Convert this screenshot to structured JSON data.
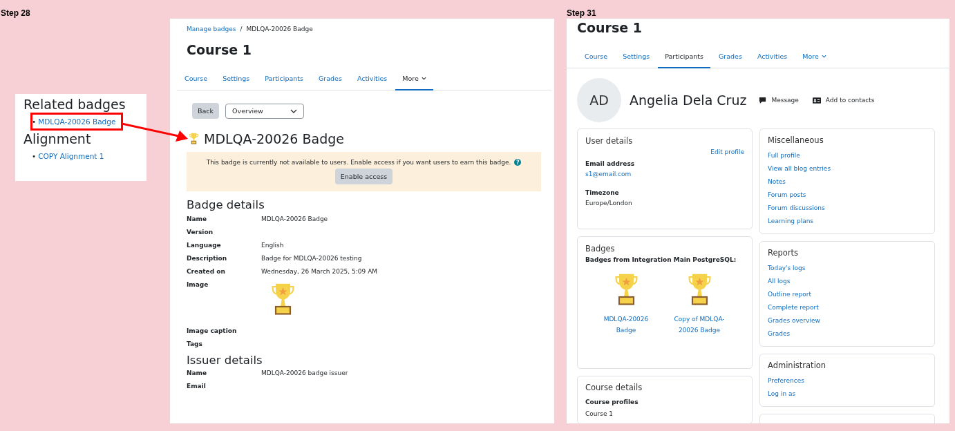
{
  "left": {
    "step": "Step 28",
    "related_heading": "Related badges",
    "related_links": [
      {
        "bullet": "•",
        "label": "MDLQA-20026 Badge",
        "highlighted": true
      }
    ],
    "alignment_heading": "Alignment",
    "alignment_links": [
      {
        "bullet": "•",
        "label": "COPY Alignment 1",
        "highlighted": false
      }
    ]
  },
  "middle": {
    "breadcrumb": [
      {
        "label": "Manage badges",
        "kind": "link"
      },
      {
        "label": "/",
        "kind": "separator"
      },
      {
        "label": "MDLQA-20026 Badge",
        "kind": "current"
      }
    ],
    "course_title": "Course 1",
    "tabs": [
      {
        "label": "Course",
        "selected": false
      },
      {
        "label": "Settings",
        "selected": false
      },
      {
        "label": "Participants",
        "selected": false
      },
      {
        "label": "Grades",
        "selected": false
      },
      {
        "label": "Activities",
        "selected": false
      },
      {
        "label": "More",
        "selected": true
      }
    ],
    "back_button": "Back",
    "select": {
      "value": "Overview"
    },
    "badge_title": "MDLQA-20026 Badge",
    "notice": {
      "text": "This badge is currently not available to users. Enable access if you want users to earn this badge.",
      "help_glyph": "?",
      "button": "Enable access"
    },
    "badge_details": {
      "heading": "Badge details",
      "rows": [
        {
          "label": "Name",
          "value": "MDLQA-20026 Badge",
          "kind": "text"
        },
        {
          "label": "Version",
          "kind": "text"
        },
        {
          "label": "Language",
          "value": "English",
          "kind": "text"
        },
        {
          "label": "Description",
          "value": "Badge for MDLQA-20026 testing",
          "kind": "text"
        },
        {
          "label": "Created on",
          "value": "Wednesday, 26 March 2025, 5:09 AM",
          "kind": "text"
        },
        {
          "label": "Image",
          "kind": "image"
        },
        {
          "label": "Image caption",
          "kind": "text"
        },
        {
          "label": "Tags",
          "kind": "text"
        }
      ]
    },
    "issuer_details": {
      "heading": "Issuer details",
      "rows": [
        {
          "label": "Name",
          "value": "MDLQA-20026 badge issuer",
          "kind": "text"
        },
        {
          "label": "Email",
          "kind": "text"
        }
      ]
    }
  },
  "right": {
    "step": "Step 31",
    "course_title": "Course 1",
    "tabs": [
      {
        "label": "Course",
        "selected": false
      },
      {
        "label": "Settings",
        "selected": false
      },
      {
        "label": "Participants",
        "selected": true
      },
      {
        "label": "Grades",
        "selected": false
      },
      {
        "label": "Activities",
        "selected": false
      },
      {
        "label": "More",
        "selected": false
      }
    ],
    "profile": {
      "initials": "AD",
      "name": "Angelia Dela Cruz",
      "actions": [
        {
          "label": "Message",
          "kind": "message"
        },
        {
          "label": "Add to contacts",
          "kind": "contact"
        }
      ]
    },
    "user_details": {
      "title": "User details",
      "edit_link": "Edit profile",
      "fields": [
        {
          "label": "Email address",
          "value": "s1@email.com",
          "kind": "link"
        },
        {
          "label": "Timezone",
          "value": "Europe/London",
          "kind": "text"
        }
      ]
    },
    "badges": {
      "title": "Badges",
      "subtitle": "Badges from Integration Main PostgreSQL:",
      "items": [
        {
          "label": "MDLQA-20026 Badge"
        },
        {
          "label": "Copy of MDLQA-20026 Badge"
        }
      ]
    },
    "course_details": {
      "title": "Course details",
      "label": "Course profiles",
      "value": "Course 1"
    },
    "link_cards": [
      {
        "title": "Miscellaneous",
        "links": [
          "Full profile",
          "View all blog entries",
          "Notes",
          "Forum posts",
          "Forum discussions",
          "Learning plans"
        ]
      },
      {
        "title": "Reports",
        "links": [
          "Today's logs",
          "All logs",
          "Outline report",
          "Complete report",
          "Grades overview",
          "Grades"
        ]
      },
      {
        "title": "Administration",
        "links": [
          "Preferences",
          "Log in as"
        ]
      }
    ]
  }
}
